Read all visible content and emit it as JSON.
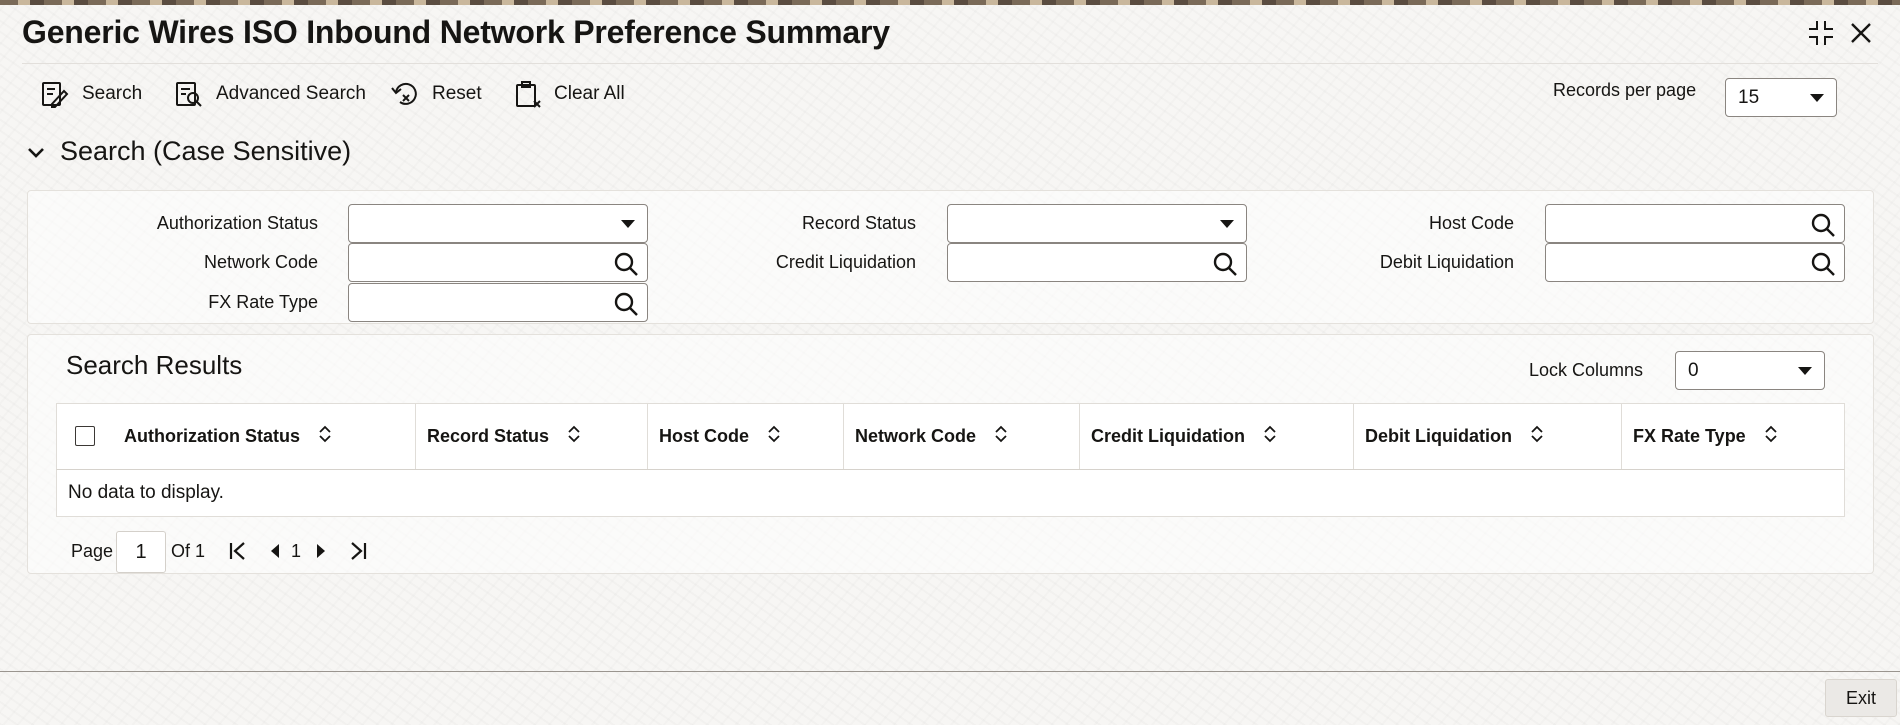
{
  "window": {
    "title": "Generic Wires ISO Inbound Network Preference Summary"
  },
  "toolbar": {
    "search_label": "Search",
    "advanced_search_label": "Advanced Search",
    "reset_label": "Reset",
    "clear_all_label": "Clear All",
    "records_per_page_label": "Records per page",
    "records_per_page_value": "15"
  },
  "search_section": {
    "heading": "Search (Case Sensitive)",
    "fields": {
      "authorization_status": {
        "label": "Authorization Status",
        "value": ""
      },
      "record_status": {
        "label": "Record Status",
        "value": ""
      },
      "host_code": {
        "label": "Host Code",
        "value": ""
      },
      "network_code": {
        "label": "Network Code",
        "value": ""
      },
      "credit_liquidation": {
        "label": "Credit Liquidation",
        "value": ""
      },
      "debit_liquidation": {
        "label": "Debit Liquidation",
        "value": ""
      },
      "fx_rate_type": {
        "label": "FX Rate Type",
        "value": ""
      }
    }
  },
  "results": {
    "title": "Search Results",
    "lock_columns_label": "Lock Columns",
    "lock_columns_value": "0",
    "columns": [
      "Authorization Status",
      "Record Status",
      "Host Code",
      "Network Code",
      "Credit Liquidation",
      "Debit Liquidation",
      "FX Rate Type"
    ],
    "empty_message": "No data to display."
  },
  "pagination": {
    "page_label": "Page",
    "current_page": "1",
    "of_label": "Of 1",
    "page_link": "1"
  },
  "footer": {
    "exit_label": "Exit"
  },
  "icons": {
    "search": "search-icon",
    "advanced_search": "advanced-search-icon",
    "reset": "reset-icon",
    "clear_all": "clear-all-icon",
    "lookup": "magnifier-icon",
    "sort": "sort-icon",
    "collapse": "chevron-down-icon",
    "maximize": "maximize-icon",
    "close": "close-icon"
  }
}
